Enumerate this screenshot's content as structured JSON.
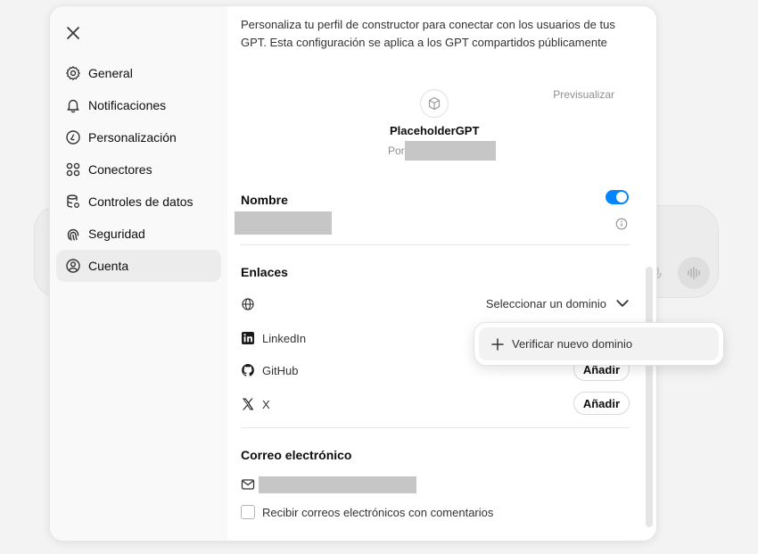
{
  "sidebar": {
    "items": [
      {
        "label": "General",
        "icon": "gear-icon"
      },
      {
        "label": "Notificaciones",
        "icon": "bell-icon"
      },
      {
        "label": "Personalización",
        "icon": "personalization-icon"
      },
      {
        "label": "Conectores",
        "icon": "connectors-icon"
      },
      {
        "label": "Controles de datos",
        "icon": "database-icon"
      },
      {
        "label": "Seguridad",
        "icon": "fingerprint-icon"
      },
      {
        "label": "Cuenta",
        "icon": "user-circle-icon",
        "active": true
      }
    ]
  },
  "content": {
    "intro": "Personaliza tu perfil de constructor para conectar con los usuarios de tus GPT. Esta configuración se aplica a los GPT compartidos públicamente",
    "preview": {
      "label": "Previsualizar",
      "gpt_name": "PlaceholderGPT",
      "by_prefix": "Por"
    },
    "name_section": {
      "title": "Nombre",
      "toggle_on": true
    },
    "links_section": {
      "title": "Enlaces",
      "domain_select": "Seleccionar un dominio",
      "links": [
        {
          "label": "LinkedIn",
          "icon": "linkedin-icon"
        },
        {
          "label": "GitHub",
          "icon": "github-icon",
          "button": "Añadir"
        },
        {
          "label": "X",
          "icon": "x-icon",
          "button": "Añadir"
        }
      ]
    },
    "email_section": {
      "title": "Correo electrónico",
      "checkbox_label": "Recibir correos electrónicos con comentarios",
      "checked": false
    }
  },
  "dropdown": {
    "item": "Verificar nuevo dominio"
  },
  "colors": {
    "accent": "#0285ff",
    "redaction": "#c6c6c6"
  }
}
